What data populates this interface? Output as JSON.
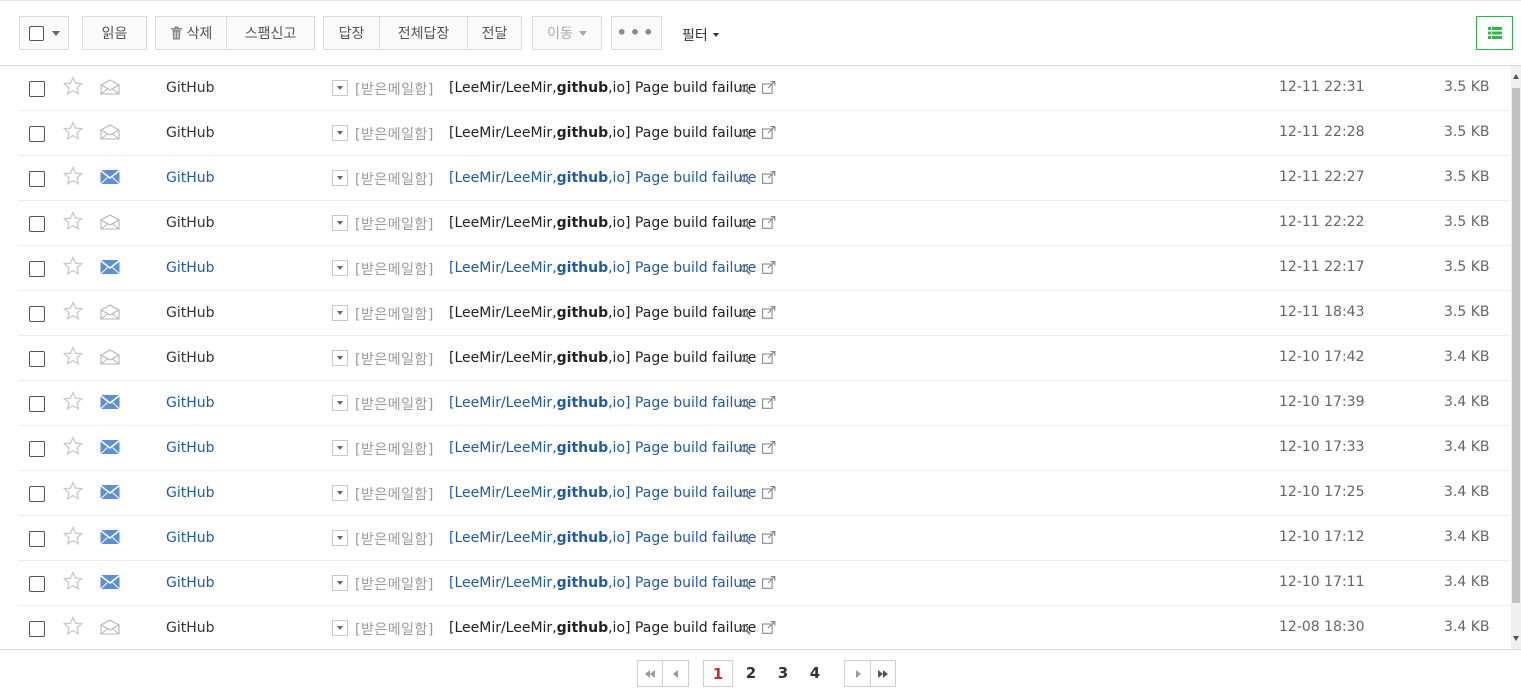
{
  "toolbar": {
    "read_label": "읽음",
    "delete_label": "삭제",
    "spam_label": "스팸신고",
    "reply_label": "답장",
    "reply_all_label": "전체답장",
    "forward_label": "전달",
    "move_label": "이동",
    "more_label": "•••",
    "filter_label": "필터"
  },
  "colors": {
    "unread_link": "#1f5aa6",
    "accent_green": "#2fb84a",
    "current_page": "#d8262f"
  },
  "mails": [
    {
      "sender": "GitHub",
      "folder": "[받은메일함]",
      "subject_pre": "[LeeMir/LeeMir,",
      "subject_bold": "github",
      "subject_post": ",io]  Page build failure",
      "date": "12-11 22:31",
      "size": "3.5 KB",
      "unread": false
    },
    {
      "sender": "GitHub",
      "folder": "[받은메일함]",
      "subject_pre": "[LeeMir/LeeMir,",
      "subject_bold": "github",
      "subject_post": ",io]  Page build failure",
      "date": "12-11 22:28",
      "size": "3.5 KB",
      "unread": false
    },
    {
      "sender": "GitHub",
      "folder": "[받은메일함]",
      "subject_pre": "[LeeMir/LeeMir,",
      "subject_bold": "github",
      "subject_post": ",io]  Page build failure",
      "date": "12-11 22:27",
      "size": "3.5 KB",
      "unread": true
    },
    {
      "sender": "GitHub",
      "folder": "[받은메일함]",
      "subject_pre": "[LeeMir/LeeMir,",
      "subject_bold": "github",
      "subject_post": ",io]  Page build failure",
      "date": "12-11 22:22",
      "size": "3.5 KB",
      "unread": false
    },
    {
      "sender": "GitHub",
      "folder": "[받은메일함]",
      "subject_pre": "[LeeMir/LeeMir,",
      "subject_bold": "github",
      "subject_post": ",io]  Page build failure",
      "date": "12-11 22:17",
      "size": "3.5 KB",
      "unread": true
    },
    {
      "sender": "GitHub",
      "folder": "[받은메일함]",
      "subject_pre": "[LeeMir/LeeMir,",
      "subject_bold": "github",
      "subject_post": ",io]  Page build failure",
      "date": "12-11 18:43",
      "size": "3.5 KB",
      "unread": false
    },
    {
      "sender": "GitHub",
      "folder": "[받은메일함]",
      "subject_pre": "[LeeMir/LeeMir,",
      "subject_bold": "github",
      "subject_post": ",io]  Page build failure",
      "date": "12-10 17:42",
      "size": "3.4 KB",
      "unread": false
    },
    {
      "sender": "GitHub",
      "folder": "[받은메일함]",
      "subject_pre": "[LeeMir/LeeMir,",
      "subject_bold": "github",
      "subject_post": ",io]  Page build failure",
      "date": "12-10 17:39",
      "size": "3.4 KB",
      "unread": true
    },
    {
      "sender": "GitHub",
      "folder": "[받은메일함]",
      "subject_pre": "[LeeMir/LeeMir,",
      "subject_bold": "github",
      "subject_post": ",io]  Page build failure",
      "date": "12-10 17:33",
      "size": "3.4 KB",
      "unread": true
    },
    {
      "sender": "GitHub",
      "folder": "[받은메일함]",
      "subject_pre": "[LeeMir/LeeMir,",
      "subject_bold": "github",
      "subject_post": ",io]  Page build failure",
      "date": "12-10 17:25",
      "size": "3.4 KB",
      "unread": true
    },
    {
      "sender": "GitHub",
      "folder": "[받은메일함]",
      "subject_pre": "[LeeMir/LeeMir,",
      "subject_bold": "github",
      "subject_post": ",io]  Page build failure",
      "date": "12-10 17:12",
      "size": "3.4 KB",
      "unread": true
    },
    {
      "sender": "GitHub",
      "folder": "[받은메일함]",
      "subject_pre": "[LeeMir/LeeMir,",
      "subject_bold": "github",
      "subject_post": ",io]  Page build failure",
      "date": "12-10 17:11",
      "size": "3.4 KB",
      "unread": true
    },
    {
      "sender": "GitHub",
      "folder": "[받은메일함]",
      "subject_pre": "[LeeMir/LeeMir,",
      "subject_bold": "github",
      "subject_post": ",io]  Page build failure",
      "date": "12-08 18:30",
      "size": "3.4 KB",
      "unread": false
    }
  ],
  "pagination": {
    "current": "1",
    "pages": [
      "2",
      "3",
      "4"
    ]
  }
}
